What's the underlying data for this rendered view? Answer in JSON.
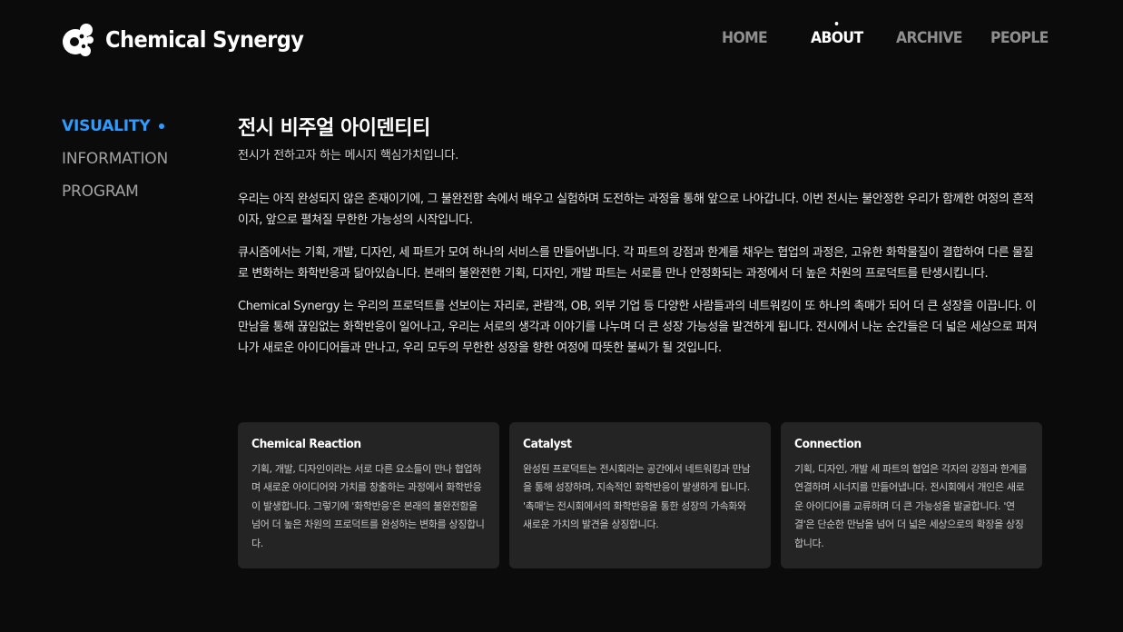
{
  "header": {
    "brand": "Chemical Synergy",
    "nav": [
      {
        "label": "HOME",
        "active": false
      },
      {
        "label": "ABOUT",
        "active": true
      },
      {
        "label": "ARCHIVE",
        "active": false
      },
      {
        "label": "PEOPLE",
        "active": false
      }
    ]
  },
  "sidebar": {
    "items": [
      {
        "label": "VISUALITY",
        "active": true
      },
      {
        "label": "INFORMATION",
        "active": false
      },
      {
        "label": "PROGRAM",
        "active": false
      }
    ]
  },
  "main": {
    "title": "전시 비주얼 아이덴티티",
    "subtitle": "전시가 전하고자 하는 메시지 핵심가치입니다.",
    "paragraphs": [
      "우리는 아직 완성되지 않은 존재이기에, 그 불완전함 속에서 배우고 실험하며 도전하는 과정을 통해 앞으로 나아갑니다. 이번 전시는 불안정한 우리가 함께한 여정의 흔적이자, 앞으로 펼쳐질 무한한 가능성의 시작입니다.",
      "큐시즘에서는 기획, 개발, 디자인, 세 파트가 모여 하나의 서비스를 만들어냅니다. 각 파트의 강점과 한계를 채우는 협업의 과정은, 고유한 화학물질이 결합하여 다른 물질로 변화하는 화학반응과 닮아있습니다. 본래의 불완전한 기획, 디자인, 개발 파트는 서로를 만나 안정화되는 과정에서 더 높은 차원의 프로덕트를 탄생시킵니다.",
      "Chemical Synergy 는 우리의 프로덕트를 선보이는 자리로, 관람객, OB, 외부 기업 등 다양한 사람들과의 네트워킹이 또 하나의 촉매가 되어 더 큰 성장을 이끕니다. 이 만남을 통해 끊임없는 화학반응이 일어나고, 우리는 서로의 생각과 이야기를 나누며 더 큰 성장 가능성을 발견하게 됩니다. 전시에서 나눈 순간들은 더 넓은 세상으로 퍼져나가 새로운 아이디어들과 만나고, 우리 모두의 무한한 성장을 향한 여정에 따뜻한 불씨가 될 것입니다."
    ]
  },
  "cards": [
    {
      "title": "Chemical Reaction",
      "text": "기획, 개발, 디자인이라는 서로 다른 요소들이 만나 협업하며 새로운 아이디어와 가치를 창출하는 과정에서 화학반응이 발생합니다. 그렇기에 '화학반응'은 본래의 불완전함을 넘어 더 높은 차원의 프로덕트를 완성하는 변화를 상징합니다."
    },
    {
      "title": "Catalyst",
      "text": "완성된 프로덕트는 전시회라는 공간에서 네트워킹과 만남을 통해 성장하며, 지속적인 화학반응이 발생하게 됩니다. '촉매'는 전시회에서의 화학반응을 통한 성장의 가속화와 새로운 가치의 발견을 상징합니다."
    },
    {
      "title": "Connection",
      "text": "기획, 디자인, 개발 세 파트의 협업은 각자의 강점과 한계를 연결하며 시너지를 만들어냅니다. 전시회에서 개인은 새로운 아이디어를 교류하며 더 큰 가능성을 발굴합니다. '연결'은 단순한 만남을 넘어 더 넓은 세상으로의 확장을 상징합니다."
    }
  ],
  "colors": {
    "background": "#0b0b0b",
    "accent": "#2f9bff",
    "card": "#242424",
    "nav_inactive": "#8f8f8f"
  }
}
